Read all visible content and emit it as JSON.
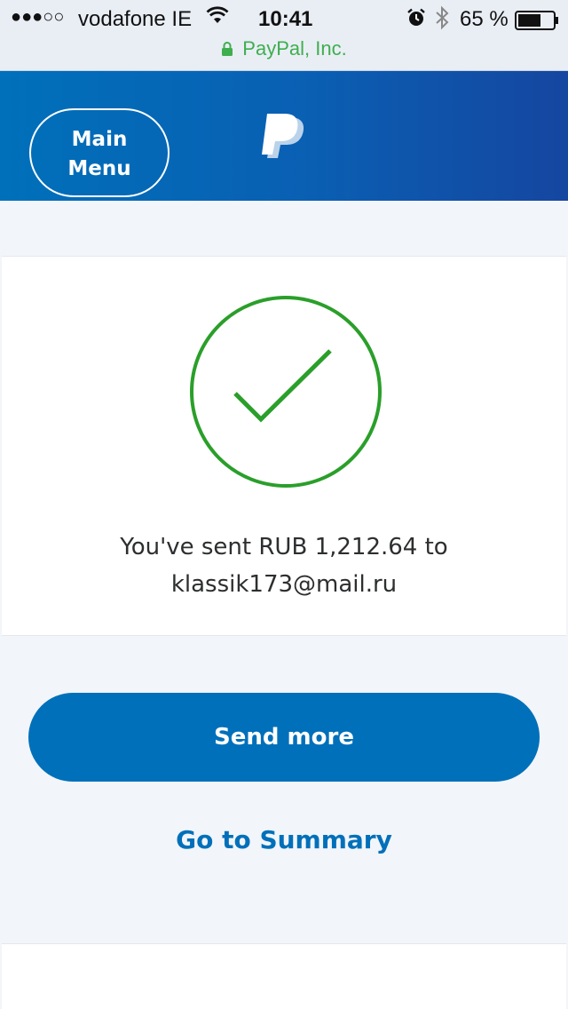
{
  "status_bar": {
    "signal": "●●●○○",
    "carrier": "vodafone IE",
    "time": "10:41",
    "battery_percent": "65 %",
    "battery_level": 0.65,
    "icons": [
      "wifi-icon",
      "alarm-icon",
      "bluetooth-icon",
      "battery-icon"
    ]
  },
  "address_bar": {
    "site": "PayPal, Inc.",
    "icon": "lock-icon",
    "color": "#3fae4f"
  },
  "header": {
    "menu_label_line1": "Main",
    "menu_label_line2": "Menu",
    "logo": "paypal-logo",
    "color": "#0070ba"
  },
  "confirmation": {
    "icon": "checkmark-circle-icon",
    "icon_color": "#2a9f2a",
    "message_line1": "You've sent RUB 1,212.64 to",
    "message_line2": "klassik173@mail.ru"
  },
  "actions": {
    "send_more": "Send more",
    "go_to_summary": "Go to Summary",
    "accent": "#0070ba"
  }
}
